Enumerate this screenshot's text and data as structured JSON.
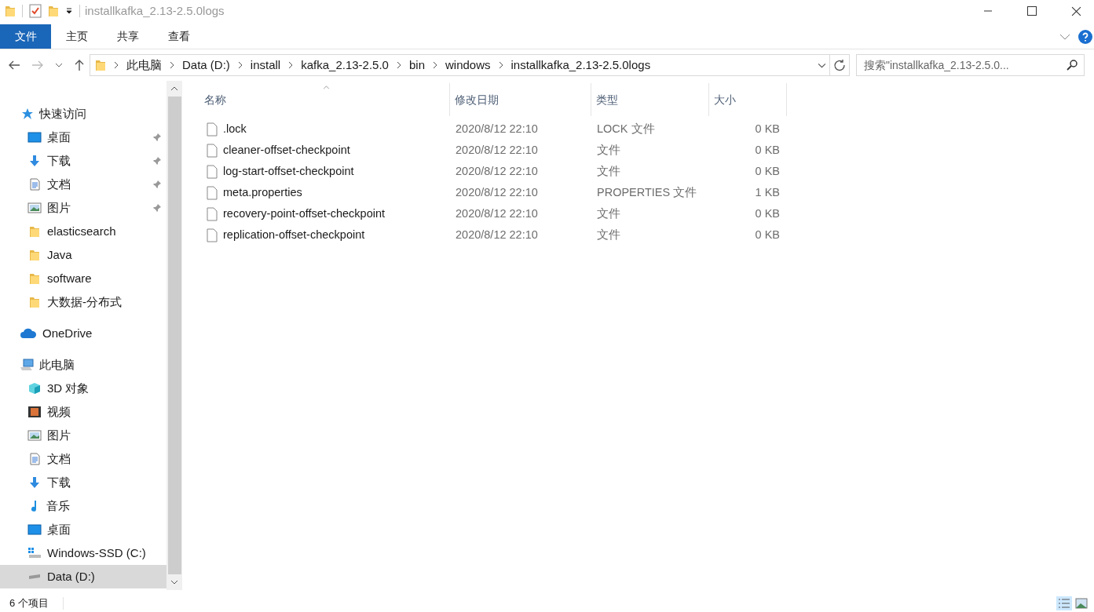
{
  "window": {
    "title": "installkafka_2.13-2.5.0logs"
  },
  "ribbon_tabs": [
    {
      "label": "文件",
      "kind": "file"
    },
    {
      "label": "主页",
      "kind": "tab"
    },
    {
      "label": "共享",
      "kind": "tab"
    },
    {
      "label": "查看",
      "kind": "tab"
    }
  ],
  "breadcrumbs": [
    "此电脑",
    "Data (D:)",
    "install",
    "kafka_2.13-2.5.0",
    "bin",
    "windows",
    "installkafka_2.13-2.5.0logs"
  ],
  "search": {
    "placeholder": "搜索\"installkafka_2.13-2.5.0..."
  },
  "sidebar": {
    "items": [
      {
        "label": "快速访问",
        "kind": "star",
        "selected": false,
        "children": [
          {
            "label": "桌面",
            "kind": "desktop",
            "pinned": true,
            "selected": false
          },
          {
            "label": "下载",
            "kind": "download",
            "pinned": true,
            "selected": false
          },
          {
            "label": "文档",
            "kind": "document",
            "pinned": true,
            "selected": false
          },
          {
            "label": "图片",
            "kind": "picture",
            "pinned": true,
            "selected": false
          },
          {
            "label": "elasticsearch",
            "kind": "folder",
            "pinned": false,
            "selected": false
          },
          {
            "label": "Java",
            "kind": "folder",
            "pinned": false,
            "selected": false
          },
          {
            "label": "software",
            "kind": "folder",
            "pinned": false,
            "selected": false
          },
          {
            "label": "大数据-分布式",
            "kind": "folder",
            "pinned": false,
            "selected": false
          }
        ]
      },
      {
        "label": "OneDrive",
        "kind": "cloud",
        "selected": false
      },
      {
        "label": "此电脑",
        "kind": "pc",
        "selected": false,
        "children": [
          {
            "label": "3D 对象",
            "kind": "cube",
            "pinned": false,
            "selected": false
          },
          {
            "label": "视频",
            "kind": "video",
            "pinned": false,
            "selected": false
          },
          {
            "label": "图片",
            "kind": "picture",
            "pinned": false,
            "selected": false
          },
          {
            "label": "文档",
            "kind": "document",
            "pinned": false,
            "selected": false
          },
          {
            "label": "下载",
            "kind": "download",
            "pinned": false,
            "selected": false
          },
          {
            "label": "音乐",
            "kind": "music",
            "pinned": false,
            "selected": false
          },
          {
            "label": "桌面",
            "kind": "desktop",
            "pinned": false,
            "selected": false
          },
          {
            "label": "Windows-SSD (C:)",
            "kind": "drive-win",
            "pinned": false,
            "selected": false
          },
          {
            "label": "Data (D:)",
            "kind": "drive",
            "pinned": false,
            "selected": true
          }
        ]
      }
    ]
  },
  "table": {
    "columns": [
      "名称",
      "修改日期",
      "类型",
      "大小"
    ],
    "rows": [
      {
        "name": ".lock",
        "modified": "2020/8/12 22:10",
        "type": "LOCK 文件",
        "size": "0 KB"
      },
      {
        "name": "cleaner-offset-checkpoint",
        "modified": "2020/8/12 22:10",
        "type": "文件",
        "size": "0 KB"
      },
      {
        "name": "log-start-offset-checkpoint",
        "modified": "2020/8/12 22:10",
        "type": "文件",
        "size": "0 KB"
      },
      {
        "name": "meta.properties",
        "modified": "2020/8/12 22:10",
        "type": "PROPERTIES 文件",
        "size": "1 KB"
      },
      {
        "name": "recovery-point-offset-checkpoint",
        "modified": "2020/8/12 22:10",
        "type": "文件",
        "size": "0 KB"
      },
      {
        "name": "replication-offset-checkpoint",
        "modified": "2020/8/12 22:10",
        "type": "文件",
        "size": "0 KB"
      }
    ]
  },
  "status_bar": {
    "item_count": "6 个项目"
  }
}
